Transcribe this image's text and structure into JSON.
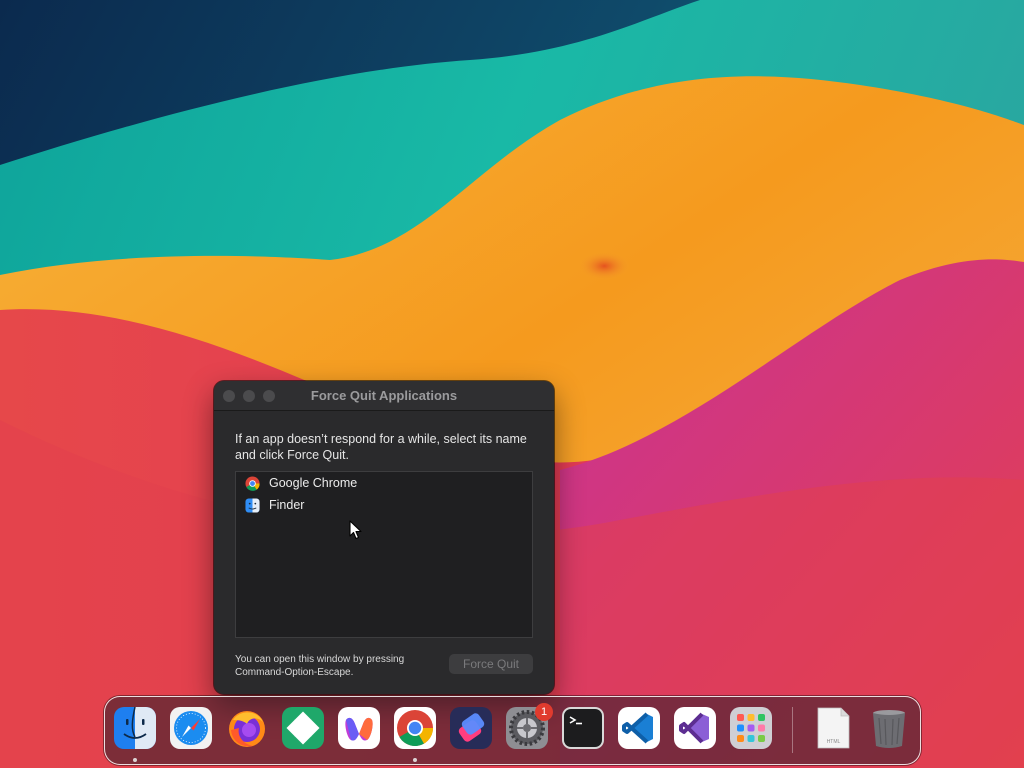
{
  "force_quit": {
    "title": "Force Quit Applications",
    "instructions": "If an app doesn’t respond for a while, select its name and click Force Quit.",
    "apps": [
      {
        "name": "Google Chrome",
        "icon": "chrome-icon"
      },
      {
        "name": "Finder",
        "icon": "finder-icon"
      }
    ],
    "hint": "You can open this window by pressing Command-Option-Escape.",
    "button_label": "Force Quit"
  },
  "dock": {
    "apps": [
      {
        "name": "Finder",
        "icon": "finder-icon",
        "running": true
      },
      {
        "name": "Safari",
        "icon": "safari-icon",
        "running": false
      },
      {
        "name": "Firefox",
        "icon": "firefox-icon",
        "running": false
      },
      {
        "name": "Xcode Cloud / App",
        "icon": "green-app-icon",
        "running": false
      },
      {
        "name": "Microsoft 365",
        "icon": "office-icon",
        "running": false
      },
      {
        "name": "Google Chrome",
        "icon": "chrome-icon",
        "running": true
      },
      {
        "name": "Shortcuts",
        "icon": "shortcuts-icon",
        "running": false
      },
      {
        "name": "System Settings",
        "icon": "settings-icon",
        "running": false,
        "badge": "1"
      },
      {
        "name": "Terminal",
        "icon": "terminal-icon",
        "running": false
      },
      {
        "name": "Visual Studio Code",
        "icon": "vscode-icon",
        "running": false
      },
      {
        "name": "Visual Studio",
        "icon": "visual-studio-icon",
        "running": false
      },
      {
        "name": "Launchpad",
        "icon": "launchpad-icon",
        "running": false
      },
      {
        "name": "HTML document",
        "icon": "html-file-icon",
        "running": false
      },
      {
        "name": "Trash",
        "icon": "trash-icon",
        "running": false
      }
    ],
    "settings_badge": "1",
    "html_file_label": "HTML"
  },
  "colors": {
    "window_bg": "#2a2a2c",
    "list_bg": "#1f1f21",
    "badge": "#e03b2e"
  }
}
